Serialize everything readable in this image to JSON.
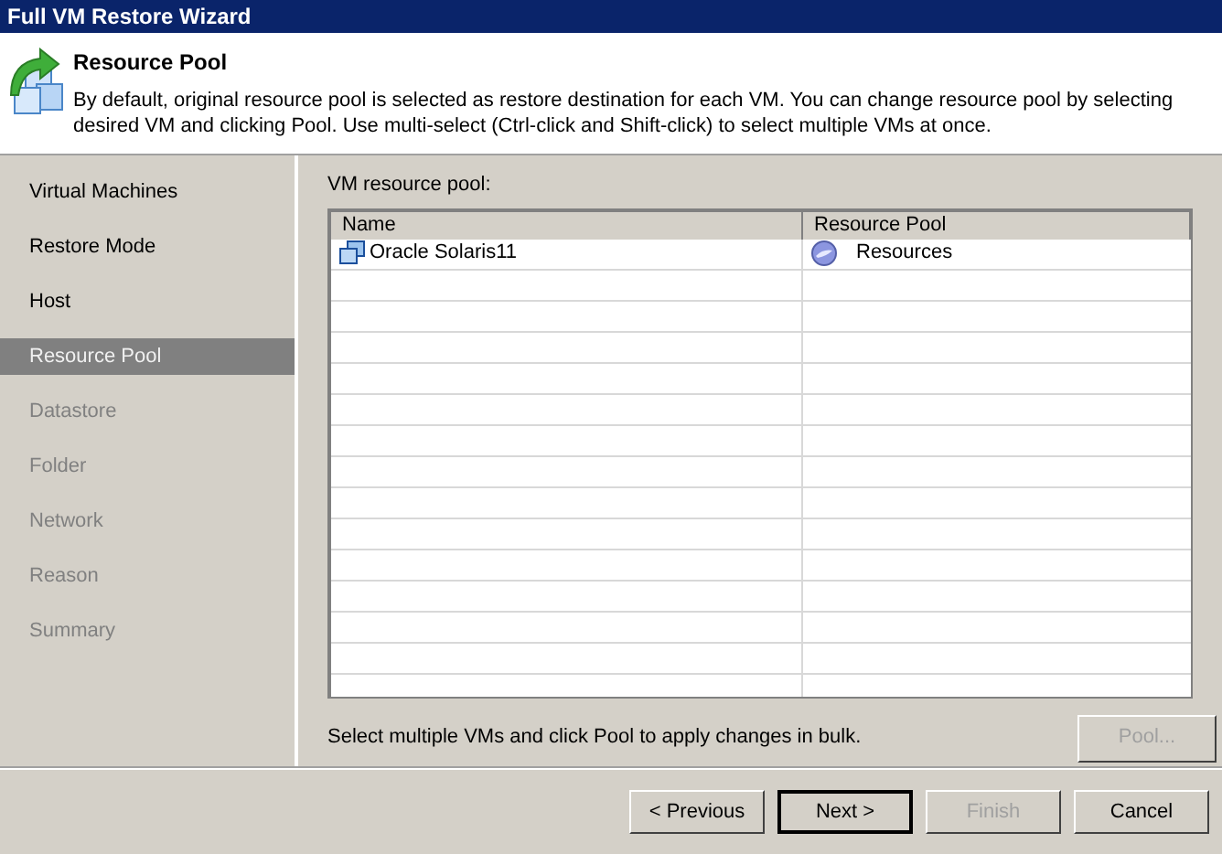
{
  "window": {
    "title": "Full VM Restore Wizard"
  },
  "header": {
    "title": "Resource Pool",
    "description": "By default, original resource pool is selected as restore destination for each VM. You can change resource pool by selecting desired VM and clicking Pool. Use multi-select (Ctrl-click and Shift-click) to select multiple VMs at once."
  },
  "steps": [
    {
      "label": "Virtual Machines",
      "selected": false,
      "disabled": false
    },
    {
      "label": "Restore Mode",
      "selected": false,
      "disabled": false
    },
    {
      "label": "Host",
      "selected": false,
      "disabled": false
    },
    {
      "label": "Resource Pool",
      "selected": true,
      "disabled": false
    },
    {
      "label": "Datastore",
      "selected": false,
      "disabled": true
    },
    {
      "label": "Folder",
      "selected": false,
      "disabled": true
    },
    {
      "label": "Network",
      "selected": false,
      "disabled": true
    },
    {
      "label": "Reason",
      "selected": false,
      "disabled": true
    },
    {
      "label": "Summary",
      "selected": false,
      "disabled": true
    }
  ],
  "table": {
    "label": "VM resource pool:",
    "columns": [
      "Name",
      "Resource Pool"
    ],
    "rows": [
      {
        "name": "Oracle Solaris11",
        "pool": "Resources"
      }
    ]
  },
  "hint": "Select multiple VMs and click Pool to apply changes in bulk.",
  "pool_button": {
    "label": "Pool...",
    "disabled": true
  },
  "buttons": [
    {
      "label": "< Previous",
      "disabled": false,
      "default": false
    },
    {
      "label": "Next >",
      "disabled": false,
      "default": true
    },
    {
      "label": "Finish",
      "disabled": true,
      "default": false
    },
    {
      "label": "Cancel",
      "disabled": false,
      "default": false
    }
  ]
}
